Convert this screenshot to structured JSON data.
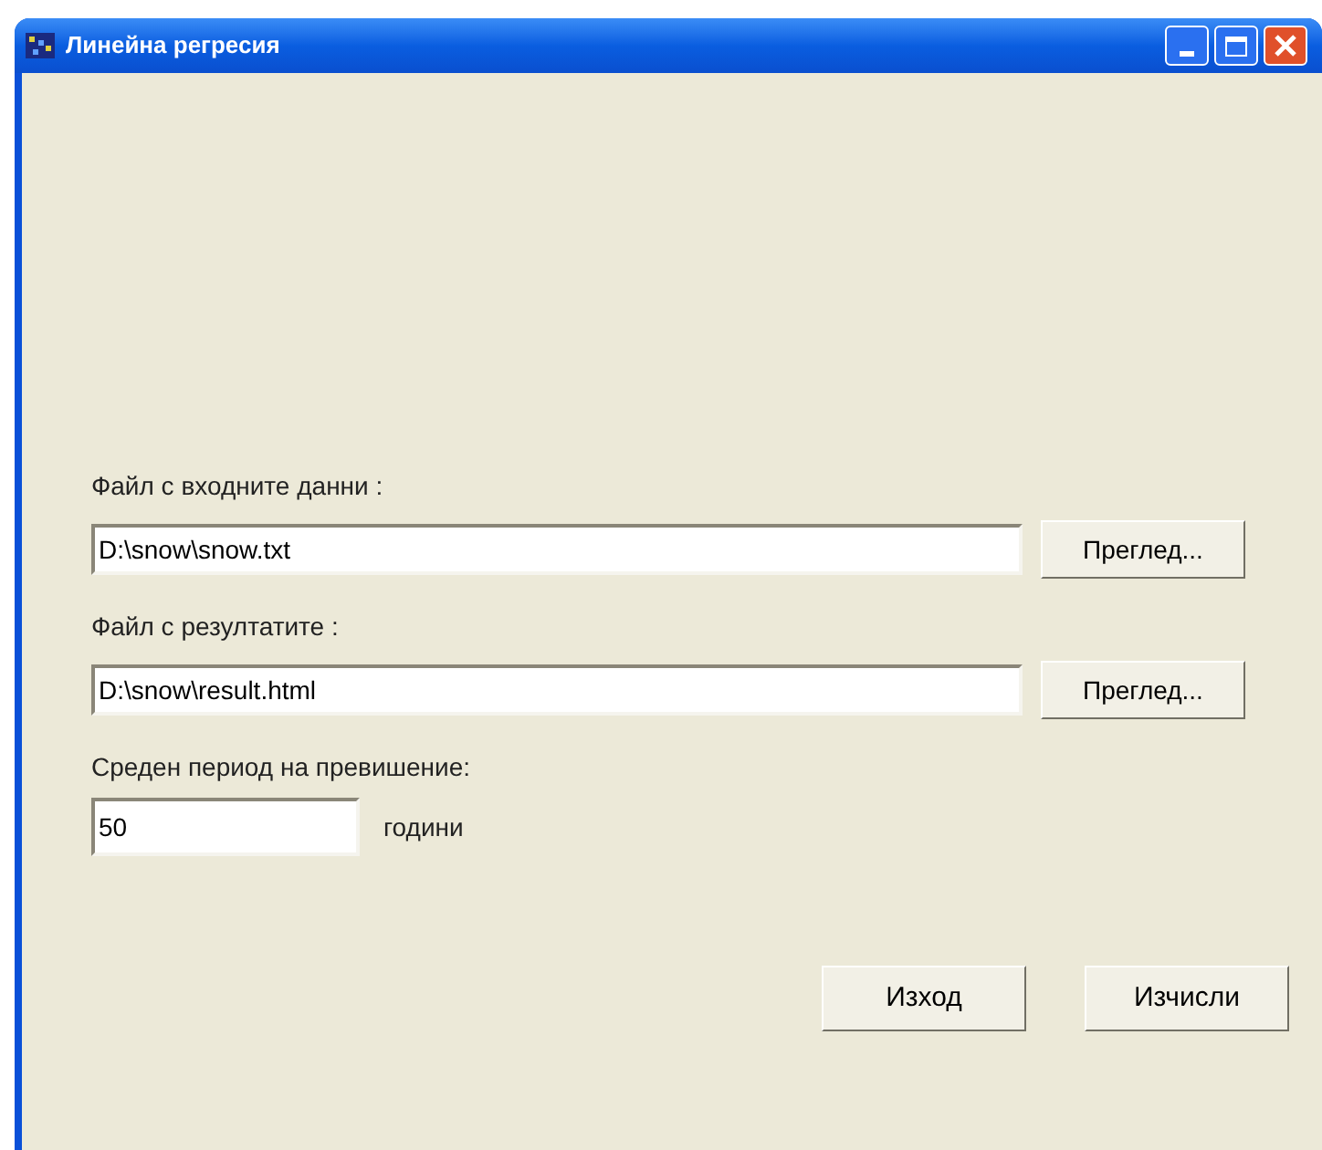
{
  "window": {
    "title": "Линейна регресия"
  },
  "fields": [
    {
      "label": "Файл с входните данни :",
      "value": "D:\\snow\\snow.txt",
      "button": "Преглед..."
    },
    {
      "label": "Файл с резултатите :",
      "value": "D:\\snow\\result.html",
      "button": "Преглед..."
    }
  ],
  "period": {
    "label": "Среден период на превишение:",
    "value": "50",
    "unit": "години"
  },
  "buttons": [
    "Изход",
    "Изчисли"
  ]
}
